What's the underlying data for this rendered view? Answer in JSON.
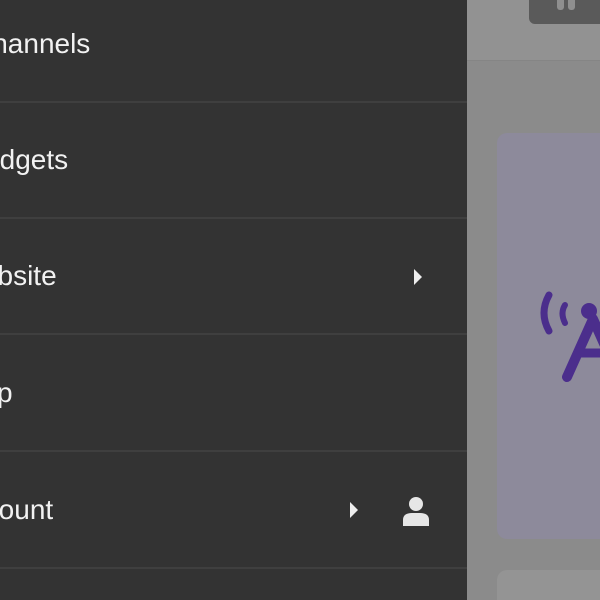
{
  "menu": {
    "items": [
      {
        "label": "Channels",
        "has_submenu": false
      },
      {
        "label": "Widgets",
        "has_submenu": false
      },
      {
        "label": "Website",
        "has_submenu": true
      },
      {
        "label": "Help",
        "has_submenu": false
      },
      {
        "label": "Account",
        "has_submenu": true,
        "icon": "person-icon"
      }
    ]
  },
  "colors": {
    "drawer_bg": "#333333",
    "divider": "#3f3f3f",
    "text": "#f2f2f2",
    "brand_purple": "#4b2e8c",
    "overlay_bg": "#8b8b8b"
  }
}
